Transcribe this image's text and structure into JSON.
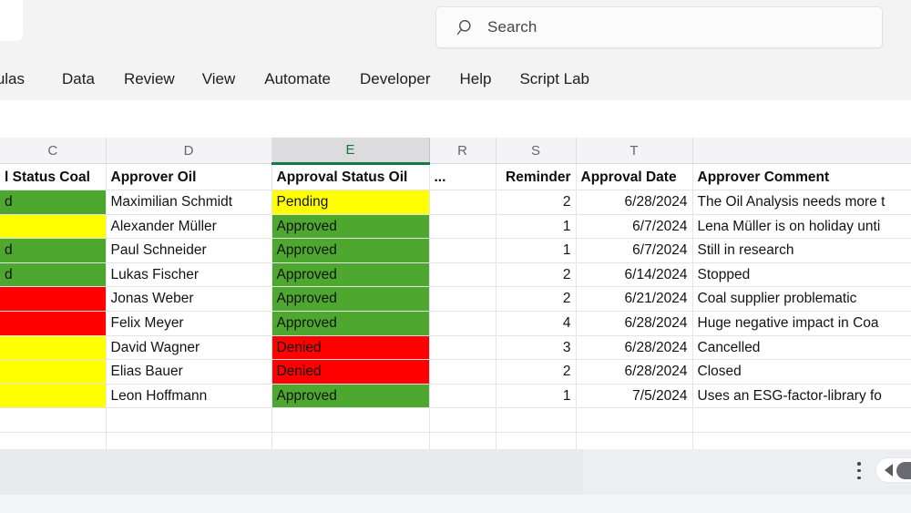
{
  "app": {
    "search": {
      "placeholder": "Search",
      "icon": "search-icon"
    },
    "collapse_icon": "chevron-down-icon"
  },
  "ribbon": {
    "tabs": [
      {
        "label": "rmulas",
        "clipped": true
      },
      {
        "label": "Data",
        "clipped": false
      },
      {
        "label": "Review",
        "clipped": false
      },
      {
        "label": "View",
        "clipped": false
      },
      {
        "label": "Automate",
        "clipped": false
      },
      {
        "label": "Developer",
        "clipped": false
      },
      {
        "label": "Help",
        "clipped": false
      },
      {
        "label": "Script Lab",
        "clipped": false
      }
    ]
  },
  "grid": {
    "column_letters": [
      "C",
      "D",
      "E",
      "R",
      "S",
      "T",
      ""
    ],
    "selected_column": "E",
    "headers": [
      "l Status Coal",
      "Approver Oil",
      "Approval Status Oil",
      "...",
      "Reminder",
      "Approval Date",
      "Approver Comment"
    ],
    "rows": [
      {
        "status_coal": "d",
        "status_coal_fill": "green",
        "approver_oil": "Maximilian Schmidt",
        "status_oil": "Pending",
        "status_oil_fill": "yellow",
        "more": "",
        "reminder": "2",
        "approval_date": "6/28/2024",
        "comment": "The Oil Analysis needs more t"
      },
      {
        "status_coal": "",
        "status_coal_fill": "yellow",
        "approver_oil": "Alexander Müller",
        "status_oil": "Approved",
        "status_oil_fill": "green",
        "more": "",
        "reminder": "1",
        "approval_date": "6/7/2024",
        "comment": "Lena Müller is on holiday unti"
      },
      {
        "status_coal": "d",
        "status_coal_fill": "green",
        "approver_oil": "Paul Schneider",
        "status_oil": "Approved",
        "status_oil_fill": "green",
        "more": "",
        "reminder": "1",
        "approval_date": "6/7/2024",
        "comment": "Still in research"
      },
      {
        "status_coal": "d",
        "status_coal_fill": "green",
        "approver_oil": "Lukas Fischer",
        "status_oil": "Approved",
        "status_oil_fill": "green",
        "more": "",
        "reminder": "2",
        "approval_date": "6/14/2024",
        "comment": "Stopped"
      },
      {
        "status_coal": "",
        "status_coal_fill": "red",
        "approver_oil": "Jonas Weber",
        "status_oil": "Approved",
        "status_oil_fill": "green",
        "more": "",
        "reminder": "2",
        "approval_date": "6/21/2024",
        "comment": "Coal supplier problematic"
      },
      {
        "status_coal": "",
        "status_coal_fill": "red",
        "approver_oil": "Felix Meyer",
        "status_oil": "Approved",
        "status_oil_fill": "green",
        "more": "",
        "reminder": "4",
        "approval_date": "6/28/2024",
        "comment": "Huge negative impact in  Coa"
      },
      {
        "status_coal": "",
        "status_coal_fill": "yellow",
        "approver_oil": "David Wagner",
        "status_oil": "Denied",
        "status_oil_fill": "red",
        "more": "",
        "reminder": "3",
        "approval_date": "6/28/2024",
        "comment": "Cancelled"
      },
      {
        "status_coal": "",
        "status_coal_fill": "yellow",
        "approver_oil": "Elias Bauer",
        "status_oil": "Denied",
        "status_oil_fill": "red",
        "more": "",
        "reminder": "2",
        "approval_date": "6/28/2024",
        "comment": "Closed"
      },
      {
        "status_coal": "",
        "status_coal_fill": "yellow",
        "approver_oil": "Leon Hoffmann",
        "status_oil": "Approved",
        "status_oil_fill": "green",
        "more": "",
        "reminder": "1",
        "approval_date": "7/5/2024",
        "comment": "Uses an ESG-factor-library fo"
      },
      {
        "status_coal": "",
        "status_coal_fill": "none",
        "approver_oil": "",
        "status_oil": "",
        "status_oil_fill": "none",
        "more": "",
        "reminder": "",
        "approval_date": "",
        "comment": ""
      },
      {
        "status_coal": "",
        "status_coal_fill": "none",
        "approver_oil": "",
        "status_oil": "",
        "status_oil_fill": "none",
        "more": "",
        "reminder": "",
        "approval_date": "",
        "comment": ""
      },
      {
        "status_coal": "",
        "status_coal_fill": "none",
        "approver_oil": "",
        "status_oil": "",
        "status_oil_fill": "none",
        "more": "",
        "reminder": "",
        "approval_date": "",
        "comment": ""
      }
    ]
  },
  "statusbar": {
    "options_icon": "kebab-menu-icon",
    "scroll_left_icon": "scroll-left-arrow-icon"
  },
  "colors": {
    "approved_green": "#4EA72E",
    "pending_yellow": "#FFFF00",
    "denied_red": "#FF0000",
    "excel_accent": "#107C41"
  }
}
